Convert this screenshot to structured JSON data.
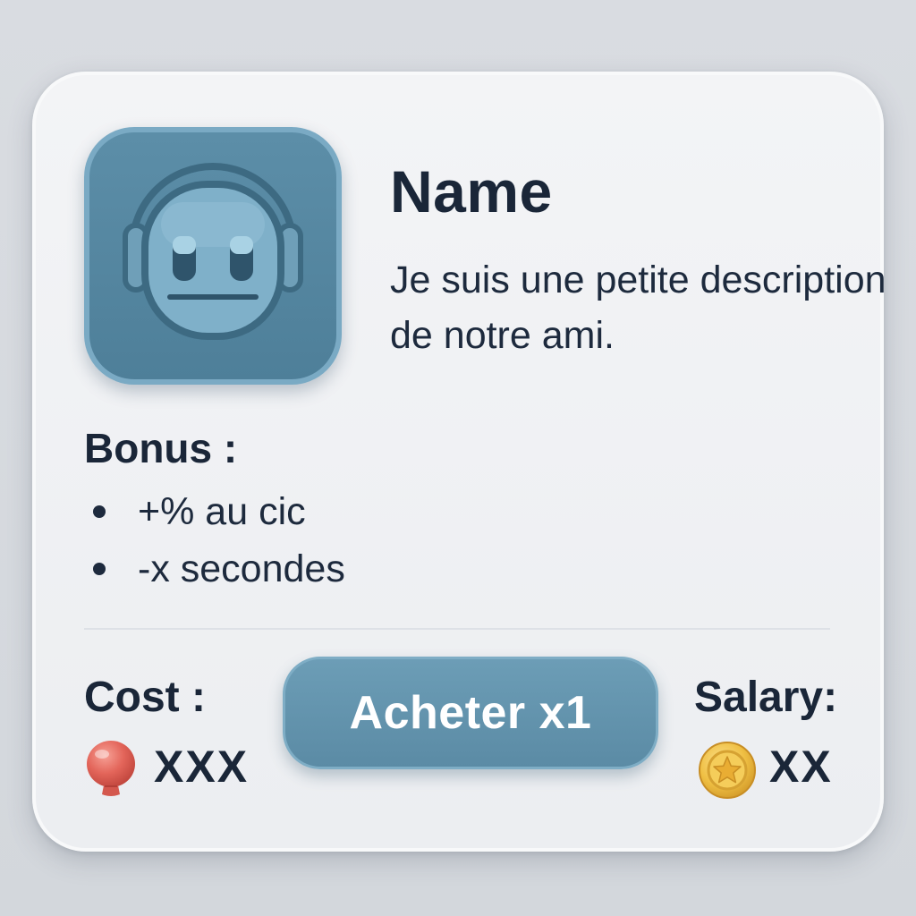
{
  "card": {
    "name": "Name",
    "description": "Je suis une petite description de notre ami.",
    "avatar_icon": "robot-head-icon"
  },
  "bonus": {
    "title": "Bonus :",
    "items": [
      "+% au cic",
      "-x secondes"
    ]
  },
  "cost": {
    "label": "Cost :",
    "icon": "red-balloon-icon",
    "value": "XXX"
  },
  "buy_button": {
    "label": "Acheter x1"
  },
  "salary": {
    "label": "Salary:",
    "icon": "gold-star-coin-icon",
    "value": "XX"
  },
  "colors": {
    "accent": "#5b8ba5",
    "text": "#1a2638",
    "card_background": "#eff1f3",
    "cost_icon": "#e0665c",
    "salary_icon": "#e8b53a"
  }
}
